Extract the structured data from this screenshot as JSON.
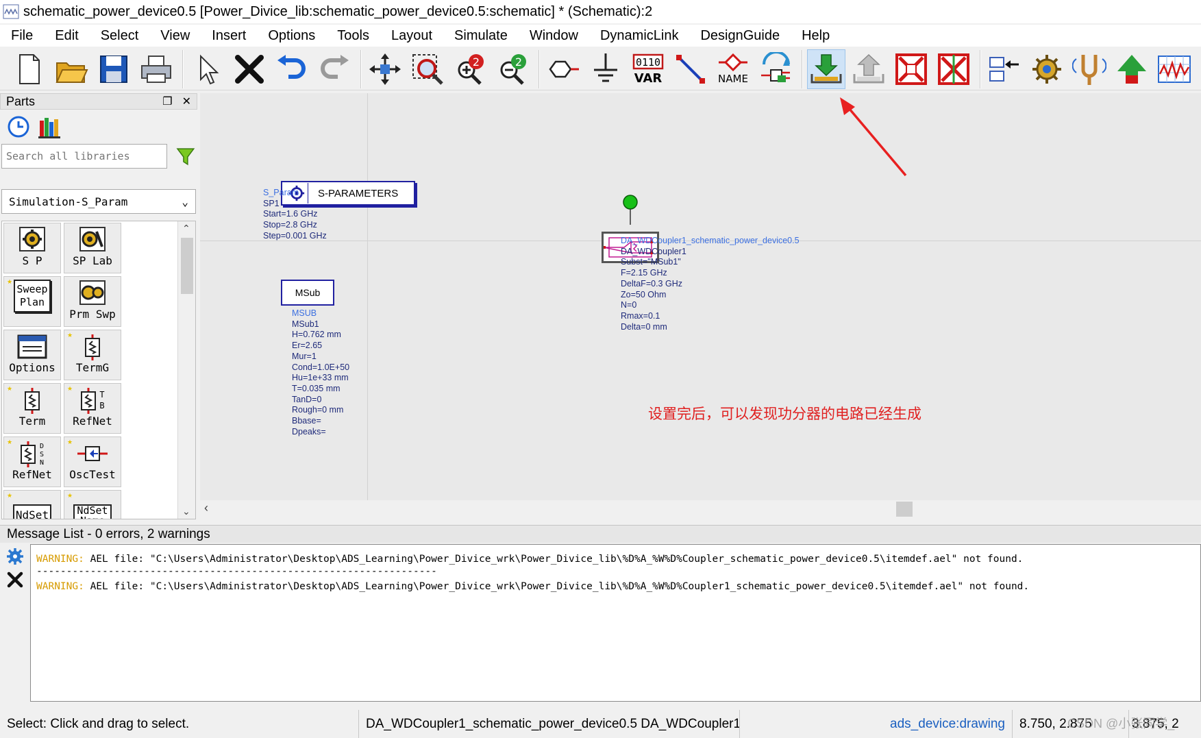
{
  "window": {
    "title": "schematic_power_device0.5 [Power_Divice_lib:schematic_power_device0.5:schematic] * (Schematic):2"
  },
  "menu": [
    "File",
    "Edit",
    "Select",
    "View",
    "Insert",
    "Options",
    "Tools",
    "Layout",
    "Simulate",
    "Window",
    "DynamicLink",
    "DesignGuide",
    "Help"
  ],
  "toolbar": {
    "var_label": "VAR",
    "var_digits": "0110",
    "name_label": "NAME"
  },
  "parts": {
    "title": "Parts",
    "search_placeholder": "Search all libraries",
    "library": "Simulation-S_Param",
    "palette": [
      {
        "label": "S P",
        "icon": "gear-sp-icon"
      },
      {
        "label": "SP Lab",
        "icon": "gear-splab-icon"
      },
      {
        "label": "Sweep Plan",
        "icon": "sweep-plan-icon"
      },
      {
        "label": "Prm Swp",
        "icon": "param-sweep-icon"
      },
      {
        "label": "Options",
        "icon": "options-icon"
      },
      {
        "label": "TermG",
        "icon": "termg-icon"
      },
      {
        "label": "Term",
        "icon": "term-icon"
      },
      {
        "label": "RefNet",
        "icon": "refnet-icon"
      },
      {
        "label": "RefNet",
        "icon": "refnet-dsn-icon"
      },
      {
        "label": "OscTest",
        "icon": "osctest-icon"
      },
      {
        "label": "NdSet",
        "icon": "ndset-icon"
      },
      {
        "label": "NdSet Name",
        "icon": "ndset-name-icon"
      }
    ]
  },
  "canvas": {
    "sparam": {
      "box_label": "S-PARAMETERS",
      "lines": [
        "S_Param",
        "SP1",
        "Start=1.6 GHz",
        "Stop=2.8 GHz",
        "Step=0.001 GHz"
      ]
    },
    "msub": {
      "box_label": "MSub",
      "lines": [
        "MSUB",
        "MSub1",
        "H=0.762 mm",
        "Er=2.65",
        "Mur=1",
        "Cond=1.0E+50",
        "Hu=1e+33 mm",
        "T=0.035 mm",
        "TanD=0",
        "Rough=0 mm",
        "Bbase=",
        "Dpeaks="
      ]
    },
    "coupler": {
      "lines": [
        "DA_WDCoupler1_schematic_power_device0.5",
        "DA_WDCoupler1",
        "Subst=\"MSub1\"",
        "F=2.15 GHz",
        "DeltaF=0.3 GHz",
        "Zo=50 Ohm",
        "N=0",
        "Rmax=0.1",
        "Delta=0 mm"
      ]
    },
    "note": "设置完后，可以发现功分器的电路已经生成",
    "accent_note": "#e02020"
  },
  "messages": {
    "header": "Message List - 0 errors, 2 warnings",
    "items": [
      {
        "level": "WARNING:",
        "text": " AEL file: \"C:\\Users\\Administrator\\Desktop\\ADS_Learning\\Power_Divice_wrk\\Power_Divice_lib\\%D%A_%W%D%Coupler_schematic_power_device0.5\\itemdef.ael\" not found."
      },
      {
        "separator": "-------------------------------------------------------------------"
      },
      {
        "level": "WARNING:",
        "text": " AEL file: \"C:\\Users\\Administrator\\Desktop\\ADS_Learning\\Power_Divice_wrk\\Power_Divice_lib\\%D%A_%W%D%Coupler1_schematic_power_device0.5\\itemdef.ael\" not found."
      }
    ]
  },
  "status": {
    "hint": "Select: Click and drag to select.",
    "selection": "DA_WDCoupler1_schematic_power_device0.5 DA_WDCoupler1",
    "layer": "ads_device:drawing",
    "coord1": "8.750, 2.875",
    "coord2": "3.875, 2"
  },
  "watermark": "CSDN @小张同学_"
}
